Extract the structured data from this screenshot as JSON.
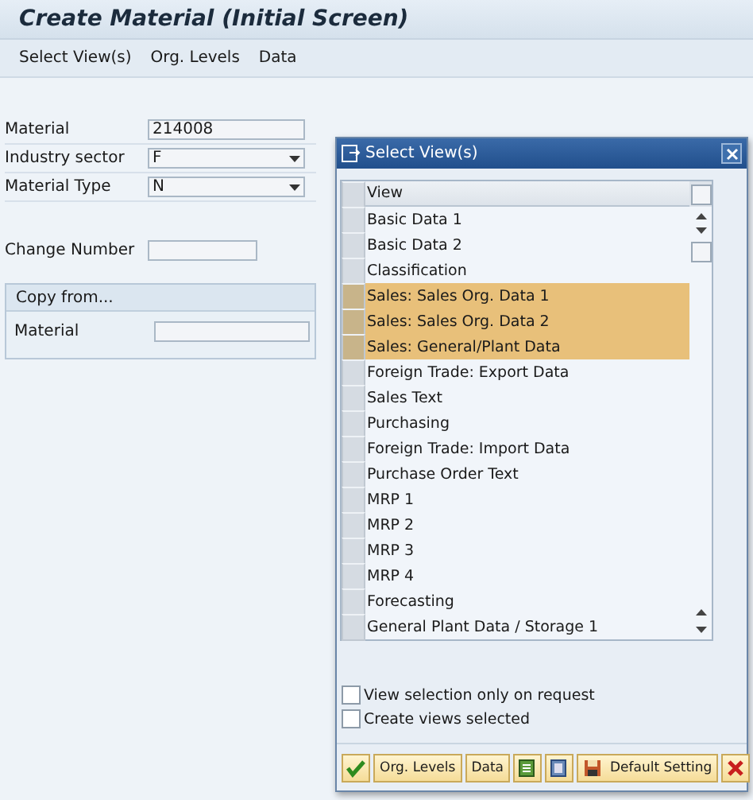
{
  "window": {
    "title": "Create Material (Initial Screen)"
  },
  "menu": [
    {
      "label": "Select View(s)"
    },
    {
      "label": "Org. Levels"
    },
    {
      "label": "Data"
    }
  ],
  "form": {
    "fields": [
      {
        "label": "Material",
        "value": "214008",
        "kind": "text"
      },
      {
        "label": "Industry sector",
        "value": "F",
        "kind": "dropdown"
      },
      {
        "label": "Material Type",
        "value": "N",
        "kind": "dropdown"
      }
    ],
    "change_number": {
      "label": "Change Number"
    },
    "copy_from": {
      "title": "Copy from...",
      "fields": [
        {
          "label": "Material"
        }
      ]
    }
  },
  "dialog": {
    "title": "Select View(s)",
    "column": "View",
    "rows": [
      {
        "label": "Basic Data 1",
        "selected": false
      },
      {
        "label": "Basic Data 2",
        "selected": false
      },
      {
        "label": "Classification",
        "selected": false
      },
      {
        "label": "Sales: Sales Org. Data 1",
        "selected": true
      },
      {
        "label": "Sales: Sales Org. Data 2",
        "selected": true
      },
      {
        "label": "Sales: General/Plant Data",
        "selected": true
      },
      {
        "label": "Foreign Trade: Export Data",
        "selected": false
      },
      {
        "label": "Sales Text",
        "selected": false
      },
      {
        "label": "Purchasing",
        "selected": false
      },
      {
        "label": "Foreign Trade: Import Data",
        "selected": false
      },
      {
        "label": "Purchase Order Text",
        "selected": false
      },
      {
        "label": "MRP 1",
        "selected": false
      },
      {
        "label": "MRP 2",
        "selected": false
      },
      {
        "label": "MRP 3",
        "selected": false
      },
      {
        "label": "MRP 4",
        "selected": false
      },
      {
        "label": "Forecasting",
        "selected": false
      },
      {
        "label": "General Plant Data / Storage 1",
        "selected": false
      }
    ],
    "options": [
      {
        "label": "View selection only on request",
        "checked": false
      },
      {
        "label": "Create views selected",
        "checked": false
      }
    ],
    "buttons": [
      {
        "kind": "ok"
      },
      {
        "kind": "text",
        "label": "Org. Levels"
      },
      {
        "kind": "text",
        "label": "Data"
      },
      {
        "kind": "select-all"
      },
      {
        "kind": "deselect-all"
      },
      {
        "kind": "save",
        "label": "Default Setting"
      },
      {
        "kind": "cancel"
      }
    ]
  }
}
